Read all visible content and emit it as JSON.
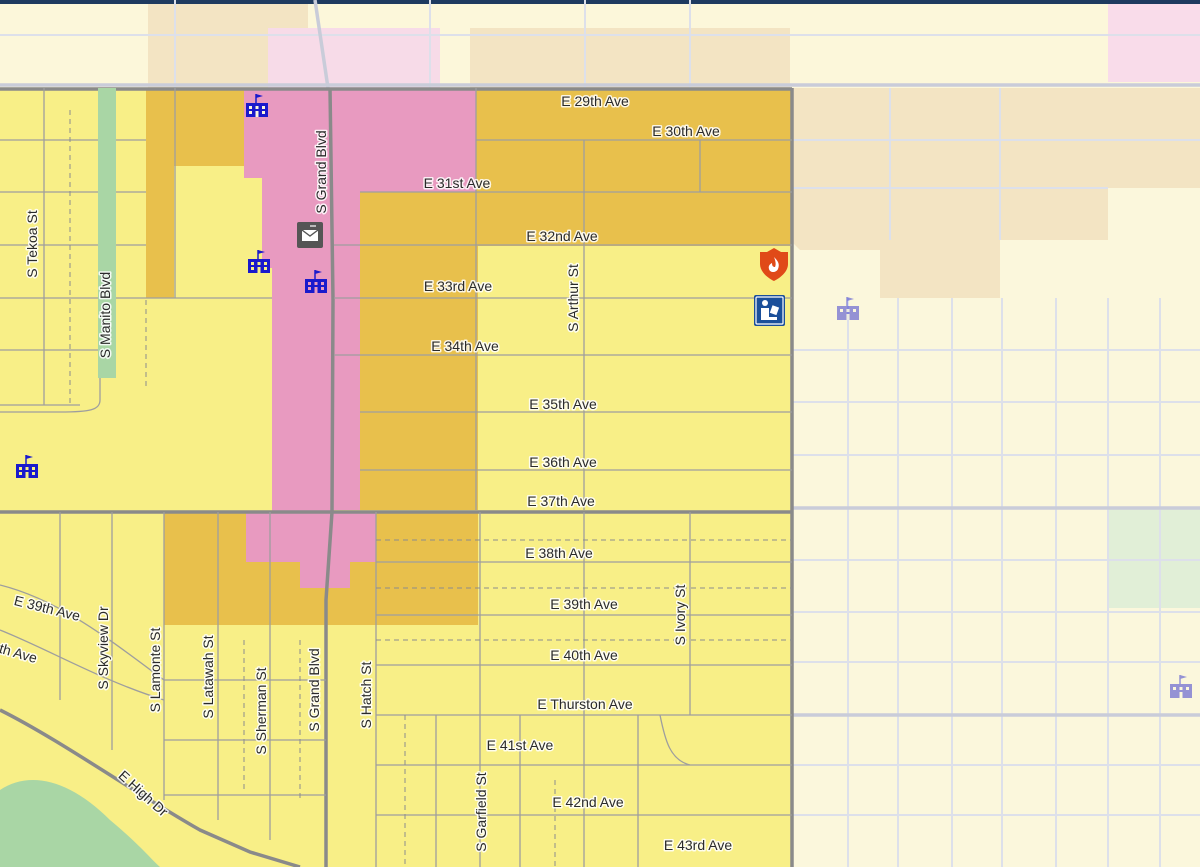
{
  "map": {
    "zone_colors": {
      "residential_single": "#f8ef87",
      "residential_multi": "#e8c04c",
      "commercial": "#e89ac0",
      "park": "#a9d6a5",
      "faded_background": "#fbf7dc",
      "faded_tan": "#f3e4c3",
      "faded_pink": "#f7dbe8",
      "road_major": "#8a8a8a",
      "road_minor": "#bdbdbd",
      "icon_blue": "#1a1acc",
      "fire_red": "#e04a18",
      "library_navy": "#1b4f9a"
    },
    "streets": {
      "e_29th": "E 29th Ave",
      "e_30th": "E 30th Ave",
      "e_31st": "E 31st Ave",
      "e_32nd": "E 32nd Ave",
      "e_33rd": "E 33rd Ave",
      "e_34th": "E 34th Ave",
      "e_35th": "E 35th Ave",
      "e_36th": "E 36th Ave",
      "e_37th": "E 37th Ave",
      "e_38th": "E 38th Ave",
      "e_39th": "E 39th Ave",
      "e_39th_west": "E 39th Ave",
      "e_40th": "E 40th Ave",
      "e_40th_west": "th Ave",
      "e_thurston": "E Thurston Ave",
      "e_41st": "E 41st Ave",
      "e_42nd": "E 42nd Ave",
      "e_43rd": "E 43rd Ave",
      "s_grand_north": "S Grand Blvd",
      "s_grand_south": "S Grand Blvd",
      "s_tekoa": "S Tekoa St",
      "s_manito": "S Manito Blvd",
      "s_arthur": "S Arthur St",
      "s_ivory": "S Ivory St",
      "s_skyview": "S Skyview Dr",
      "s_lamonte": "S Lamonte St",
      "s_latawah": "S Latawah St",
      "s_sherman": "S Sherman St",
      "s_hatch": "S Hatch St",
      "s_garfield": "S Garfield St",
      "e_high_dr": "E High Dr"
    },
    "icons": {
      "school": "school-icon",
      "post_office": "post-office-icon",
      "fire_station": "fire-station-icon",
      "library": "library-icon"
    }
  }
}
